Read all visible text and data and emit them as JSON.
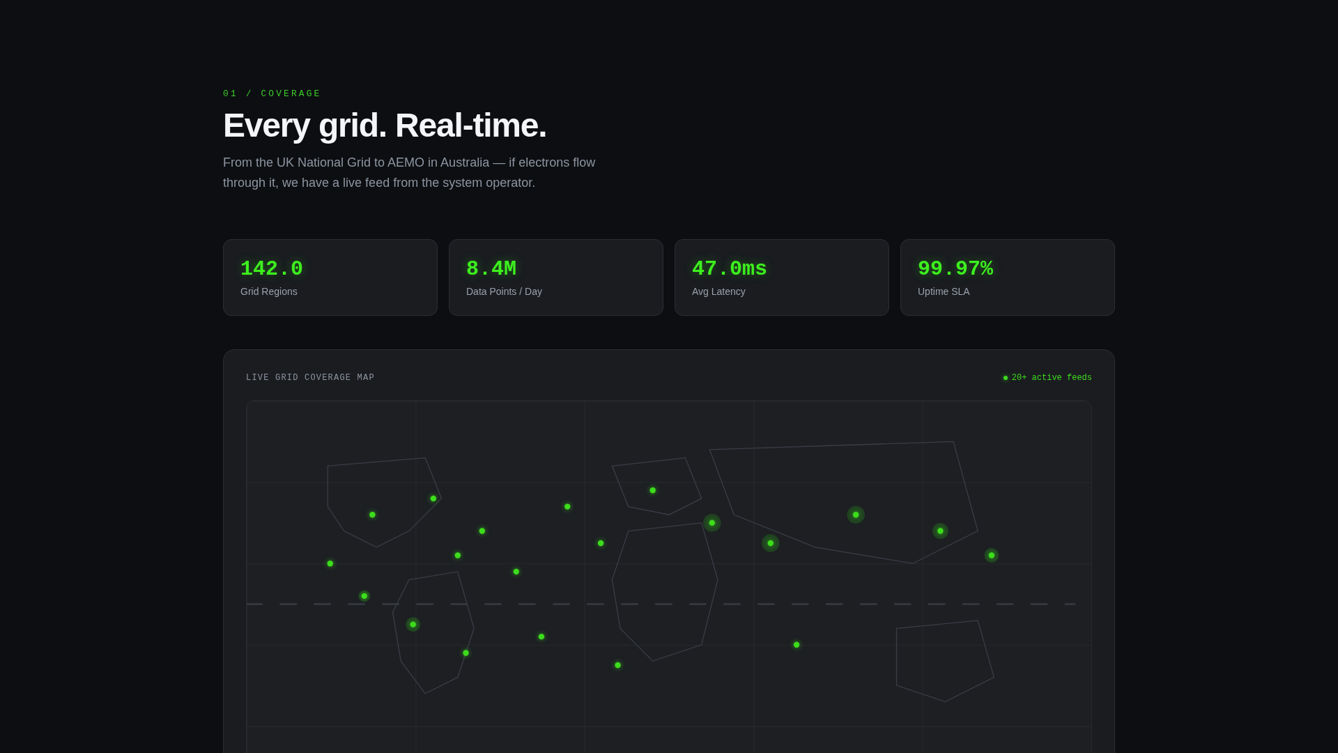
{
  "section": {
    "eyebrow": "01 / COVERAGE",
    "title": "Every grid. Real-time.",
    "description": "From the UK National Grid to AEMO in Australia — if electrons flow through it, we have a live feed from the system operator."
  },
  "stats": [
    {
      "value": "142.0",
      "label": "Grid Regions"
    },
    {
      "value": "8.4M",
      "label": "Data Points / Day"
    },
    {
      "value": "47.0ms",
      "label": "Avg Latency"
    },
    {
      "value": "99.97%",
      "label": "Uptime SLA"
    }
  ],
  "coverage_map": {
    "title": "LIVE GRID COVERAGE MAP",
    "status": "20+ active feeds"
  }
}
